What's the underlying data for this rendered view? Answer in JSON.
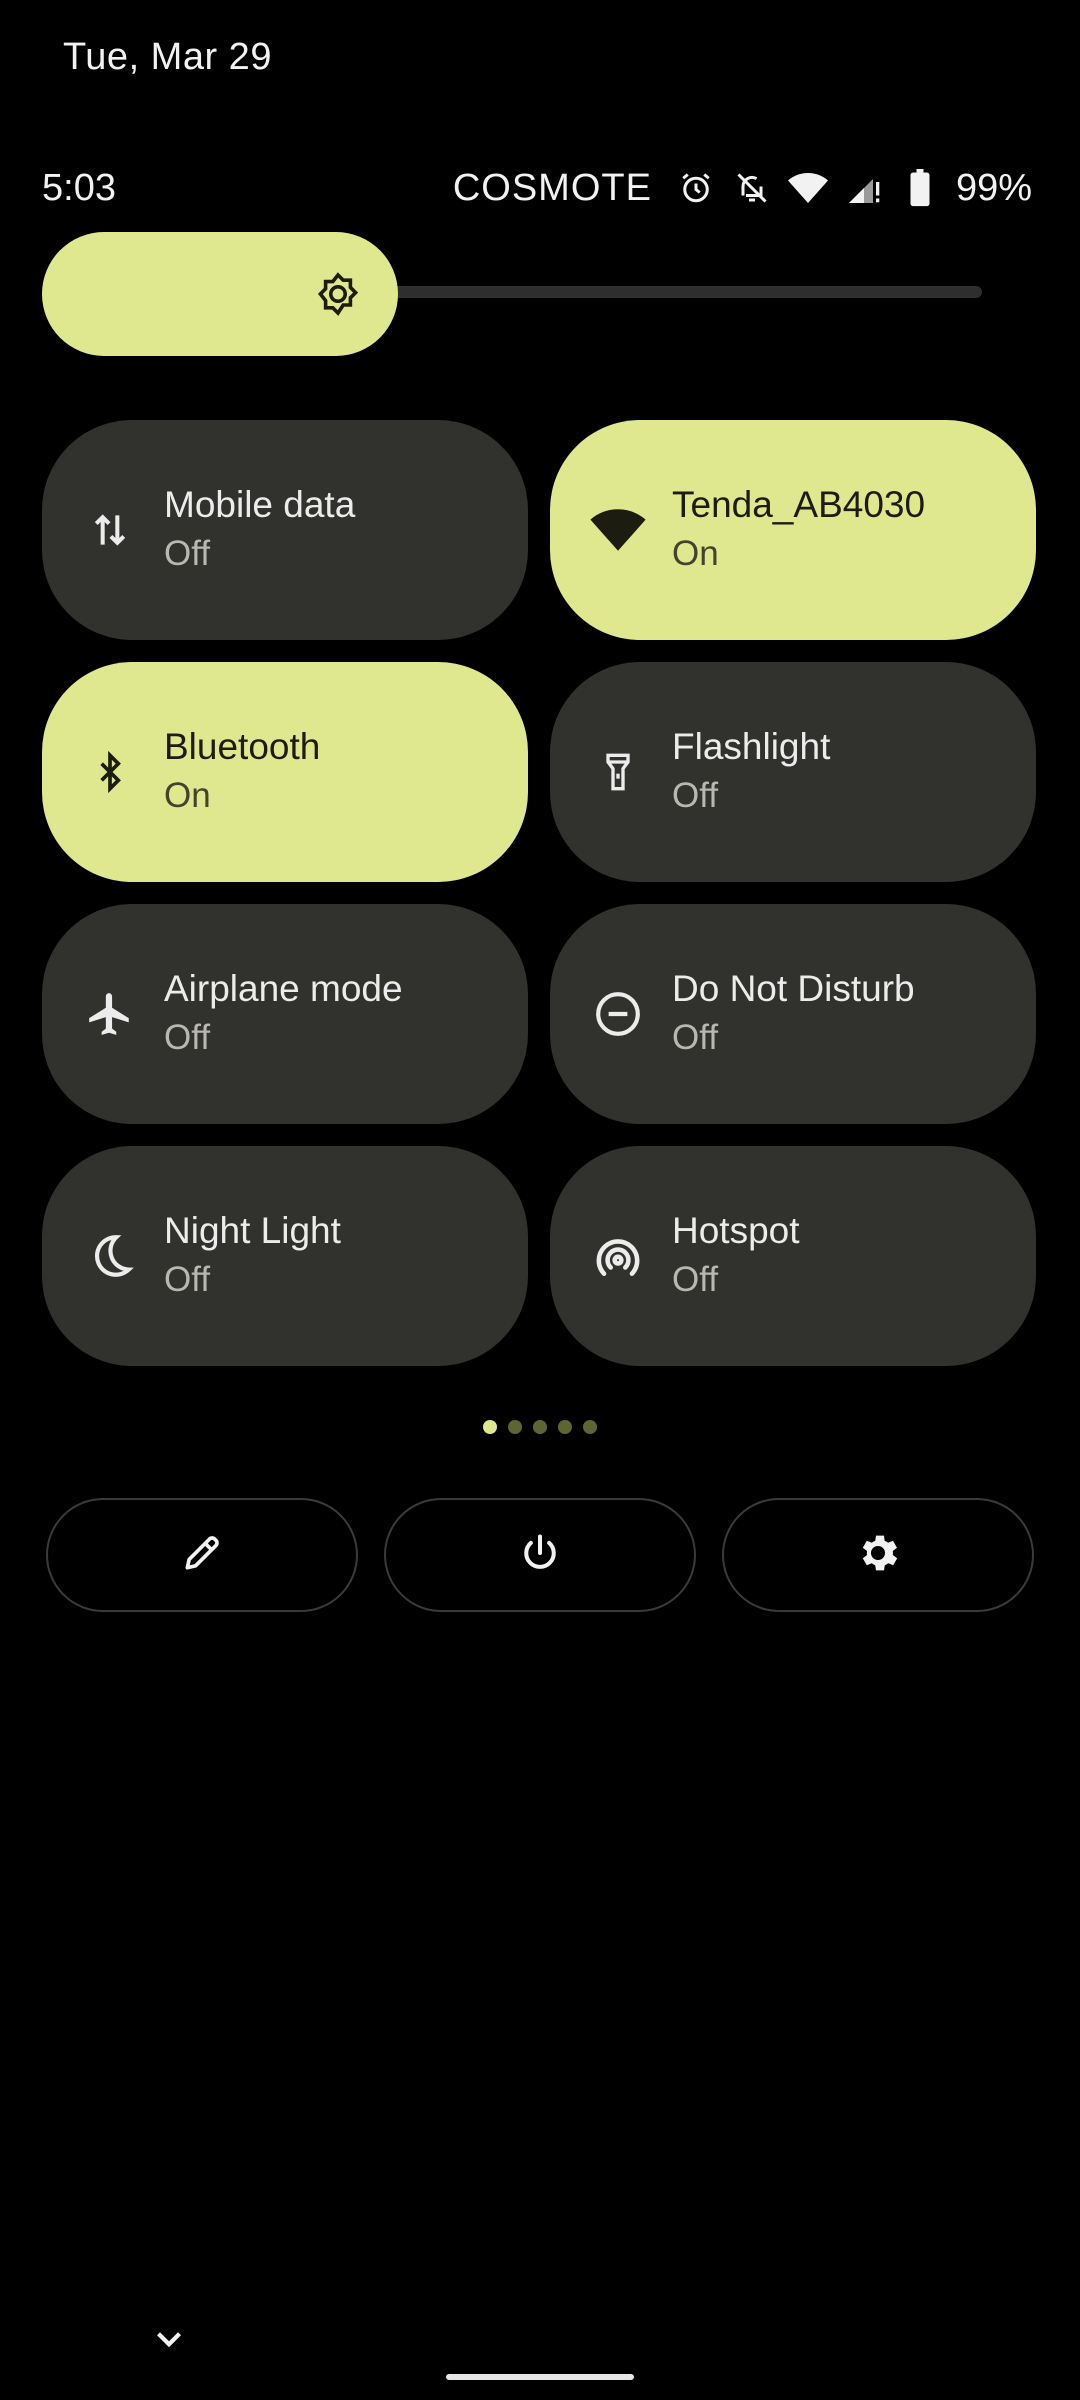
{
  "date": "Tue, Mar 29",
  "status_bar": {
    "time": "5:03",
    "carrier": "COSMOTE",
    "battery_percent": "99%",
    "icons": [
      "alarm-icon",
      "notifications-off-icon",
      "wifi-icon",
      "cell-signal-icon",
      "battery-icon"
    ]
  },
  "brightness": {
    "level": 0.25,
    "icon": "brightness-icon"
  },
  "tiles": [
    {
      "label": "Mobile data",
      "state": "Off",
      "on": false,
      "icon": "mobile-data-icon"
    },
    {
      "label": "Tenda_AB4030",
      "state": "On",
      "on": true,
      "icon": "wifi-icon"
    },
    {
      "label": "Bluetooth",
      "state": "On",
      "on": true,
      "icon": "bluetooth-icon"
    },
    {
      "label": "Flashlight",
      "state": "Off",
      "on": false,
      "icon": "flashlight-icon"
    },
    {
      "label": "Airplane mode",
      "state": "Off",
      "on": false,
      "icon": "airplane-icon"
    },
    {
      "label": "Do Not Disturb",
      "state": "Off",
      "on": false,
      "icon": "do-not-disturb-icon"
    },
    {
      "label": "Night Light",
      "state": "Off",
      "on": false,
      "icon": "night-light-icon"
    },
    {
      "label": "Hotspot",
      "state": "Off",
      "on": false,
      "icon": "hotspot-icon"
    }
  ],
  "page_indicator": {
    "total": 5,
    "active": 1
  },
  "actions": [
    {
      "icon": "edit-icon"
    },
    {
      "icon": "power-icon"
    },
    {
      "icon": "settings-icon"
    }
  ],
  "colors": {
    "accent": "#dfe88f",
    "tile_off": "#31312d",
    "background": "#000000"
  }
}
